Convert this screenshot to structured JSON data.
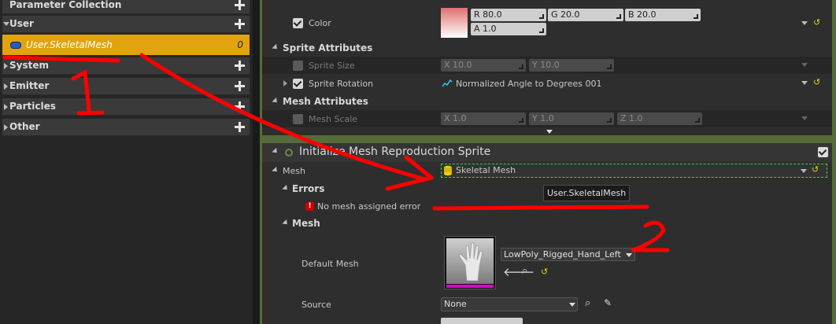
{
  "left_panel": {
    "title": "Parameter Collection",
    "sections": [
      {
        "label": "User"
      },
      {
        "label": "System"
      },
      {
        "label": "Emitter"
      },
      {
        "label": "Particles"
      },
      {
        "label": "Other"
      }
    ],
    "user_param": {
      "label": "User.SkeletalMesh",
      "count": "0"
    }
  },
  "top_panel": {
    "color_label": "Color",
    "r": "R 80.0",
    "g": "G 20.0",
    "b": "B 20.0",
    "a": "A 1.0",
    "sprite_attributes": "Sprite Attributes",
    "sprite_size_label": "Sprite Size",
    "sprite_size_x": "X 10.0",
    "sprite_size_y": "Y 10.0",
    "sprite_rotation_label": "Sprite Rotation",
    "sprite_rotation_value": "Normalized Angle to Degrees 001",
    "mesh_attributes": "Mesh Attributes",
    "mesh_scale_label": "Mesh Scale",
    "mesh_scale_x": "X 1.0",
    "mesh_scale_y": "Y 1.0",
    "mesh_scale_z": "Z 1.0"
  },
  "module": {
    "title": "Initialize Mesh Reproduction Sprite",
    "mesh_label": "Mesh",
    "mesh_value": "Skeletal Mesh",
    "errors_label": "Errors",
    "error_text": "No mesh assigned error",
    "tooltip": "User.SkeletalMesh",
    "mesh_section": "Mesh",
    "default_mesh_label": "Default Mesh",
    "default_mesh_value": "LowPoly_Rigged_Hand_Left",
    "source_label": "Source",
    "source_value": "None"
  },
  "annotations": {
    "one": "1",
    "two": "2"
  },
  "colors": {
    "accent": "#e1a40f",
    "frame": "#556b3a",
    "error": "#e00000",
    "annotation": "#ff0000"
  }
}
